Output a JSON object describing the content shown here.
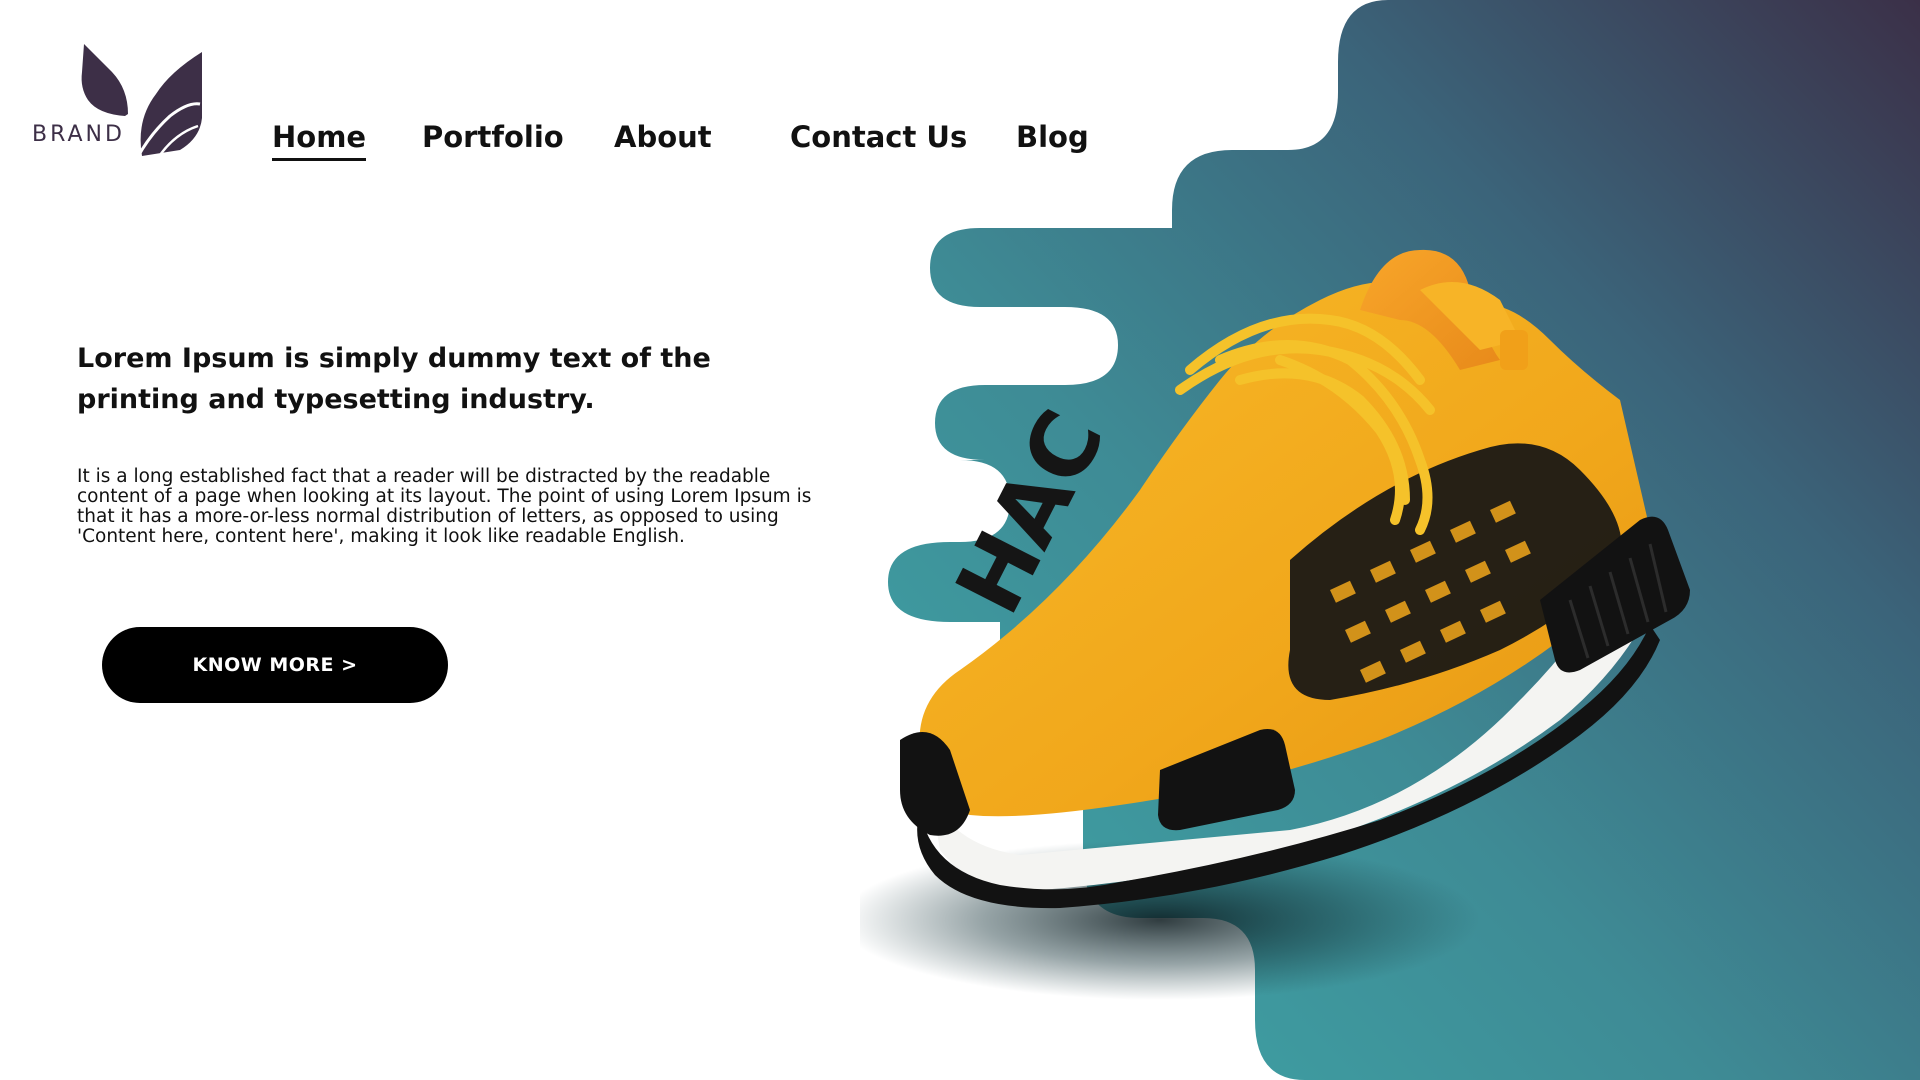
{
  "brand": {
    "name": "BRAND",
    "color": "#3d2f47",
    "icon": "leaf-icon"
  },
  "nav": {
    "items": [
      {
        "label": "Home",
        "active": true
      },
      {
        "label": "Portfolio",
        "active": false
      },
      {
        "label": "About",
        "active": false
      },
      {
        "label": "Contact Us",
        "active": false
      },
      {
        "label": "Blog",
        "active": false
      }
    ]
  },
  "hero": {
    "headline": "Lorem Ipsum is simply dummy text of the printing and typesetting industry.",
    "body": "It is a long established fact that a reader will be distracted by the readable content of a page when looking at its layout. The point of using Lorem Ipsum is that it has a more-or-less normal distribution of letters, as opposed to using 'Content here, content here', making it look like readable English.",
    "cta_label": "KNOW MORE >"
  },
  "product": {
    "image": "sneaker-image",
    "shoe_lettering": "HAC",
    "colors": {
      "upper": "#f2ac1e",
      "sole": "#ffffff",
      "accent": "#111111"
    }
  },
  "colors": {
    "background": "#ffffff",
    "gradient_teal": "#3fa4a6",
    "gradient_slate": "#3b6a7e",
    "gradient_purple": "#3b3148",
    "text": "#111111",
    "button": "#000000"
  }
}
